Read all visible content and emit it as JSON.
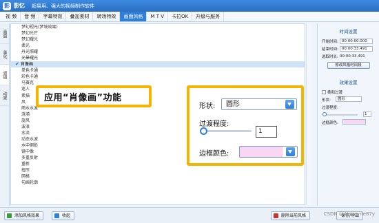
{
  "window": {
    "logo_text": "影",
    "app_name": "影忆",
    "slogan": "超易用、强大的视频制作软件"
  },
  "menu": [
    "视 频",
    "音 频",
    "字幕特效",
    "叠加素材",
    "转场特效",
    "画面风格",
    "M T V",
    "卡拉OK",
    "升级与服务"
  ],
  "menu_active_index": 5,
  "sidebar_tabs": [
    "画面",
    "美化",
    "滤镜",
    "动景"
  ],
  "sidebar_active_index": 2,
  "style_list": [
    "梦幻视光(梦境效果)",
    "梦幻光芒",
    "梦幻耀光",
    "柔光",
    "丹光照耀",
    "光晕耀光",
    "肖像画",
    "单色卡通",
    "彩色卡通",
    "马赛克",
    "迷人",
    "素描",
    "风",
    "雨水水波",
    "涟漪",
    "旋风",
    "波浪",
    "水流",
    "动态水波",
    "水中倒影",
    "镜中像",
    "多重反射",
    "重新",
    "扭压",
    "网格",
    "勾画轮廓"
  ],
  "selected_style_index": 6,
  "callout1": {
    "text": "应用“肖像画”功能"
  },
  "callout2": {
    "shape_label": "形状:",
    "shape_value": "圆形",
    "transition_label": "过渡程度:",
    "transition_value": "1",
    "transition_fraction": 0.02,
    "border_color_label": "边框颜色:",
    "border_color": "#f9d6f2"
  },
  "right_panel": {
    "time_section": "时间设置",
    "start_label": "开始时间:",
    "start_value": "00:00:00.000",
    "end_label": "结束时间:",
    "end_value": "00:00:33.491",
    "duration_label": "选取时长:",
    "duration_value": "00:00:33.491",
    "modify_button": "修改风格时间段",
    "effect_section": "效果设置",
    "soft_transition": "柔和过渡",
    "shape_label": "形状:",
    "shape_value": "圆形",
    "transition_label": "过渡程度:",
    "transition_value": "1",
    "border_label": "边框颜色:"
  },
  "bottom": {
    "add_button": "添加风格效果",
    "collapse_button": "收起",
    "delete_button": "删除当前风格",
    "save_button": "保存/导出"
  },
  "watermark": "CSDN @Alexeyne87y",
  "colors": {
    "accent": "#2f7fd8",
    "callout_border": "#f4b400",
    "selected_row": "#cfe3f8"
  }
}
